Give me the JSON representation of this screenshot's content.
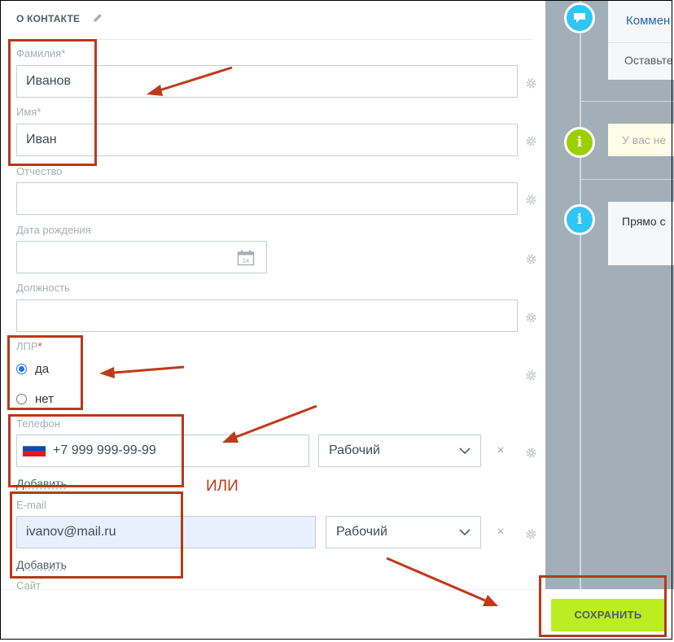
{
  "section": {
    "title": "О КОНТАКТЕ",
    "edit_icon": "pencil-icon"
  },
  "fields": {
    "last_name": {
      "label": "Фамилия",
      "required_mark": "*",
      "value": "Иванов"
    },
    "first_name": {
      "label": "Имя",
      "required_mark": "*",
      "value": "Иван"
    },
    "middle_name": {
      "label": "Отчество",
      "value": ""
    },
    "birth_date": {
      "label": "Дата рождения",
      "value": "",
      "calendar_day": "24"
    },
    "position": {
      "label": "Должность",
      "value": ""
    },
    "lpr": {
      "label": "ЛПР",
      "required_mark": "*",
      "options": [
        {
          "label": "да",
          "checked": true
        },
        {
          "label": "нет",
          "checked": false
        }
      ]
    },
    "phone": {
      "label": "Телефон",
      "value": "+7 999 999-99-99",
      "type": "Рабочий",
      "add_label": "Добавить",
      "flag": "russia-flag-icon"
    },
    "email": {
      "label": "E-mail",
      "value": "ivanov@mail.ru",
      "type": "Рабочий",
      "add_label": "Добавить"
    },
    "site": {
      "label": "Сайт"
    }
  },
  "remove_glyph": "×",
  "save_button": {
    "label": "СОХРАНИТЬ",
    "color": "#bbed21"
  },
  "timeline": {
    "tab_label": "Коммен",
    "comment_placeholder": "Оставьте",
    "notice_text": "У вас не",
    "info_text": "Прямо с",
    "icons": [
      {
        "name": "comment-icon",
        "color": "#2fc6f6"
      },
      {
        "name": "info-icon",
        "color": "#9dcf00"
      },
      {
        "name": "info-icon",
        "color": "#2fc6f6"
      }
    ]
  },
  "annotation": {
    "or_text": "ИЛИ",
    "color": "#b53a1a"
  }
}
